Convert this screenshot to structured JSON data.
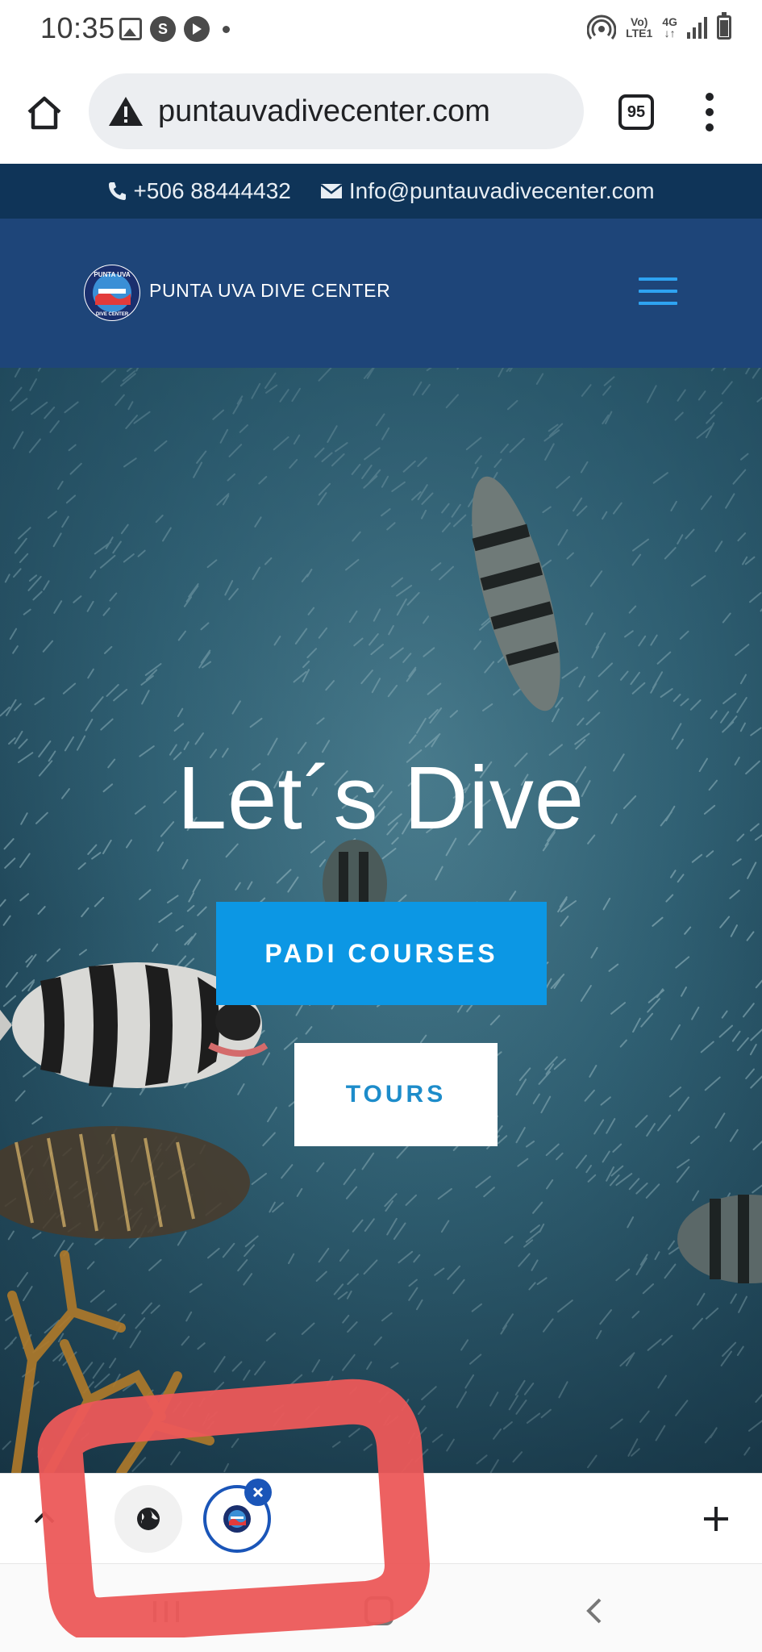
{
  "status_bar": {
    "time": "10:35",
    "network_top": "Vo)",
    "network_bottom": "LTE1",
    "network_type": "4G",
    "app_icon_letter": "S"
  },
  "browser": {
    "url": "puntauvadivecenter.com",
    "tab_count": "95",
    "icons": [
      "home-icon",
      "warning-icon",
      "tab-switcher-icon",
      "overflow-menu-icon"
    ]
  },
  "contact_bar": {
    "phone": "+506 88444432",
    "email": "Info@puntauvadivecenter.com"
  },
  "header": {
    "site_name": "PUNTA UVA DIVE CENTER",
    "logo_text_top": "PUNTA UVA",
    "logo_text_bottom": "DIVE CENTER",
    "accent_color": "#2ea3f2"
  },
  "hero": {
    "title": "Let´s Dive",
    "primary_button": "PADI COURSES",
    "secondary_button": "TOURS",
    "primary_color": "#0c97e4"
  },
  "tab_strip": {
    "tabs": [
      "globe-tab",
      "puntauva-tab"
    ]
  },
  "colors": {
    "contact_bar_bg": "#0f3458",
    "header_bg": "#1e4579",
    "annotation": "#ec5858"
  }
}
